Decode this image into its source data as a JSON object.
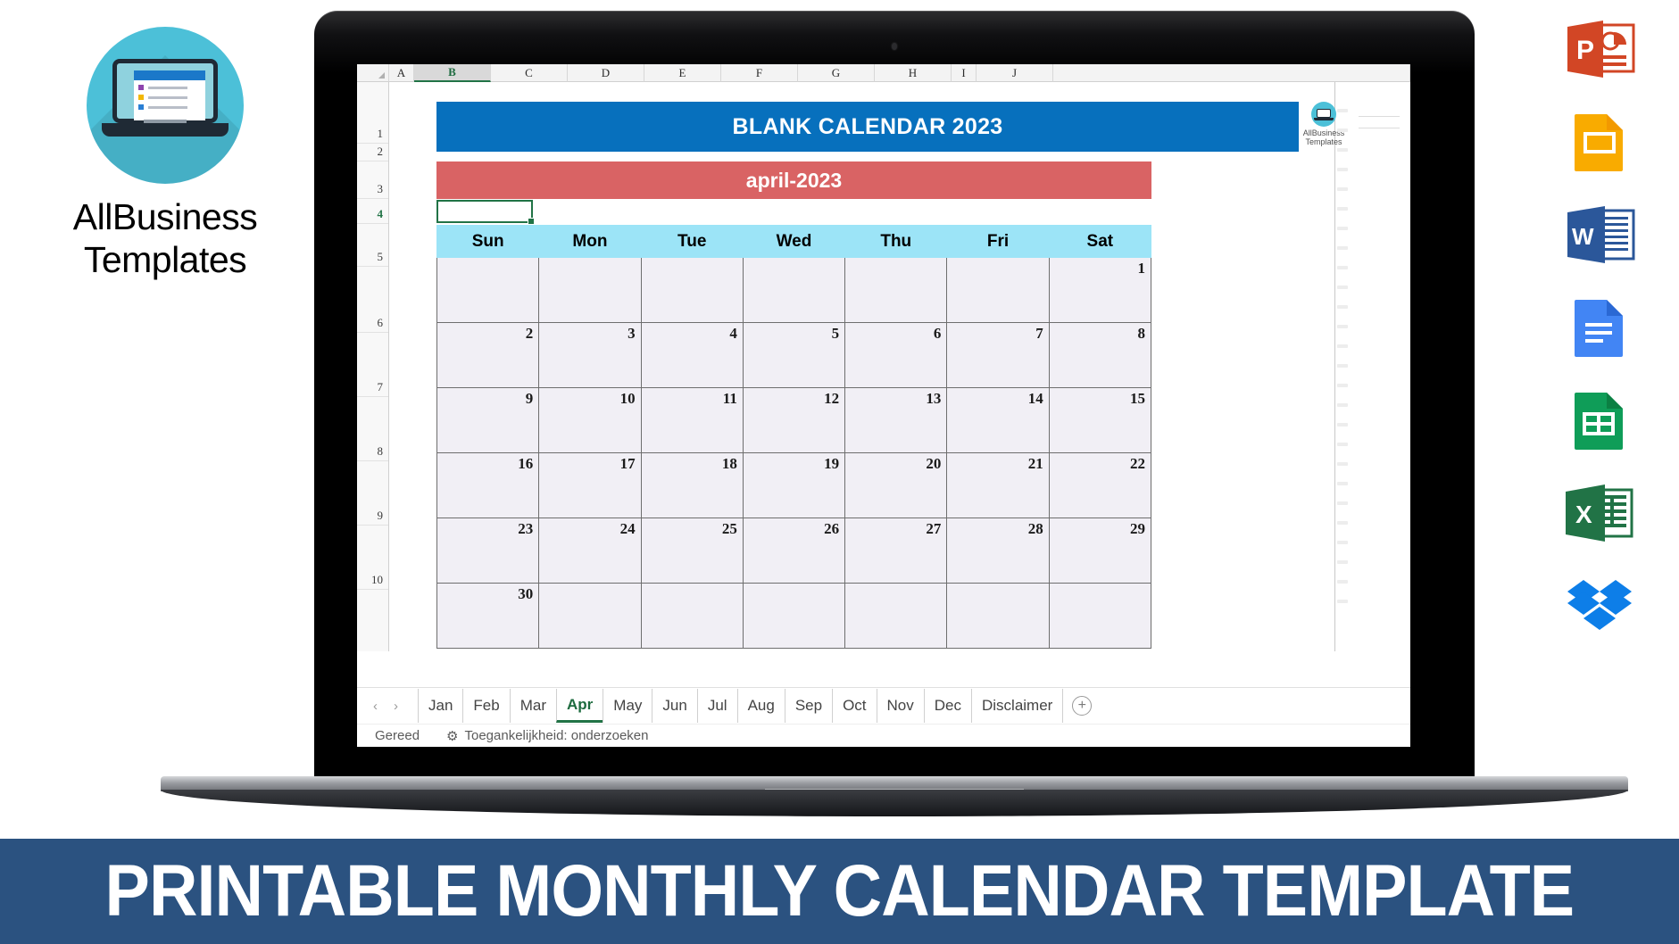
{
  "brand": {
    "name_line1": "AllBusiness",
    "name_line2": "Templates",
    "logo_icon": "laptop-circle-icon"
  },
  "spreadsheet": {
    "column_headers": [
      "A",
      "B",
      "C",
      "D",
      "E",
      "F",
      "G",
      "H",
      "I",
      "J"
    ],
    "selected_column": "B",
    "row_headers": [
      "1",
      "2",
      "3",
      "4",
      "5",
      "6",
      "7",
      "8",
      "9",
      "10"
    ],
    "selected_row": "4",
    "title": "BLANK CALENDAR 2023",
    "month_label": "april-2023",
    "title_color": "#0770bd",
    "month_color": "#d96364",
    "dayheader_color": "#9ce4f7",
    "cell_color": "#f1eff5",
    "watermark": {
      "line1": "AllBusiness",
      "line2": "Templates"
    },
    "calendar": {
      "day_names": [
        "Sun",
        "Mon",
        "Tue",
        "Wed",
        "Thu",
        "Fri",
        "Sat"
      ],
      "weeks": [
        [
          "",
          "",
          "",
          "",
          "",
          "",
          "1"
        ],
        [
          "2",
          "3",
          "4",
          "5",
          "6",
          "7",
          "8"
        ],
        [
          "9",
          "10",
          "11",
          "12",
          "13",
          "14",
          "15"
        ],
        [
          "16",
          "17",
          "18",
          "19",
          "20",
          "21",
          "22"
        ],
        [
          "23",
          "24",
          "25",
          "26",
          "27",
          "28",
          "29"
        ],
        [
          "30",
          "",
          "",
          "",
          "",
          "",
          ""
        ]
      ]
    },
    "sheet_tabs": [
      {
        "label": "Jan",
        "active": false
      },
      {
        "label": "Feb",
        "active": false
      },
      {
        "label": "Mar",
        "active": false
      },
      {
        "label": "Apr",
        "active": true
      },
      {
        "label": "May",
        "active": false
      },
      {
        "label": "Jun",
        "active": false
      },
      {
        "label": "Jul",
        "active": false
      },
      {
        "label": "Aug",
        "active": false
      },
      {
        "label": "Sep",
        "active": false
      },
      {
        "label": "Oct",
        "active": false
      },
      {
        "label": "Nov",
        "active": false
      },
      {
        "label": "Dec",
        "active": false
      },
      {
        "label": "Disclaimer",
        "active": false
      }
    ],
    "tab_nav": {
      "prev": "‹",
      "next": "›",
      "add": "+"
    },
    "status_bar": {
      "state": "Gereed",
      "accessibility": "Toegankelijkheid: onderzoeken"
    }
  },
  "app_icons": [
    {
      "name": "powerpoint-icon",
      "label": "PowerPoint",
      "color": "#d24625"
    },
    {
      "name": "google-slides-icon",
      "label": "Google Slides",
      "color": "#f9ab00"
    },
    {
      "name": "word-icon",
      "label": "Word",
      "color": "#2b579a"
    },
    {
      "name": "google-docs-icon",
      "label": "Google Docs",
      "color": "#4285f4"
    },
    {
      "name": "google-sheets-icon",
      "label": "Google Sheets",
      "color": "#0f9d58"
    },
    {
      "name": "excel-icon",
      "label": "Excel",
      "color": "#217346"
    },
    {
      "name": "dropbox-icon",
      "label": "Dropbox",
      "color": "#0d7ee8"
    }
  ],
  "banner": {
    "text": "PRINTABLE MONTHLY CALENDAR TEMPLATE",
    "background": "#2b5280"
  }
}
